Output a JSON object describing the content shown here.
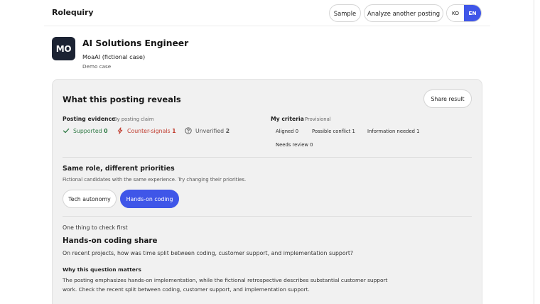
{
  "header": {
    "brand": "Rolequiry",
    "sample_label": "Sample",
    "analyze_label": "Analyze another posting",
    "lang_ko": "KO",
    "lang_en": "EN",
    "active_lang": "EN"
  },
  "job": {
    "logo_initials": "MO",
    "title": "AI Solutions Engineer",
    "company": "MoaAI (fictional case)",
    "note": "Demo case"
  },
  "reveals": {
    "title": "What this posting reveals",
    "share_label": "Share result",
    "evidence": {
      "label": "Posting evidence",
      "sub": "By posting claim",
      "supported_label": "Supported",
      "supported_count": "0",
      "counter_label": "Counter-signals",
      "counter_count": "1",
      "unverified_label": "Unverified",
      "unverified_count": "2"
    },
    "criteria": {
      "label": "My criteria",
      "sub": "Provisional",
      "aligned": "Aligned 0",
      "possible_conflict": "Possible conflict 1",
      "info_needed": "Information needed 1",
      "needs_review": "Needs review 0"
    }
  },
  "priorities": {
    "title": "Same role, different priorities",
    "subtitle": "Fictional candidates with the same experience. Try changing their priorities.",
    "options": [
      "Tech autonomy",
      "Hands-on coding"
    ],
    "selected": "Hands-on coding"
  },
  "check": {
    "label": "One thing to check first",
    "title": "Hands-on coding share",
    "question": "On recent projects, how was time split between coding, customer support, and implementation support?",
    "why_label": "Why this question matters",
    "why_body": "The posting emphasizes hands-on implementation, while the fictional retrospective describes substantial customer support work. Check the recent split between coding, customer support, and implementation support."
  },
  "colors": {
    "accent": "#3f56e8",
    "supported": "#2f7a45",
    "counter": "#c0392b",
    "logo_bg": "#1c2333"
  },
  "icons": {
    "supported": "check-icon",
    "counter": "lightning-icon",
    "unverified": "question-circle-icon"
  }
}
